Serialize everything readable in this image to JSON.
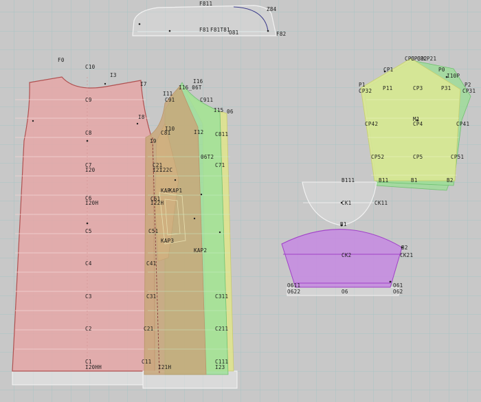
{
  "canvas": {
    "background": "#c8c8c8",
    "grid_color": "#a9c3c3"
  },
  "colors": {
    "front_piece": "#e7a8a8",
    "back_piece_tan": "#c9a67a",
    "back_piece_green": "#9fe09a",
    "back_piece_yellow": "#dfe48a",
    "sleeve_front": "#d9e795",
    "sleeve_back": "#9fdc9a",
    "collar_purple": "#c58ee0",
    "outline_white": "#efefef",
    "stroke_red": "#b05050",
    "stroke_purple": "#a040c8"
  },
  "pieces": {
    "top_collar": [
      "F811",
      "Z84",
      "F81",
      "F81T81",
      "O81",
      "F82"
    ],
    "front": [
      "F0",
      "C10",
      "I3",
      "I7",
      "C9",
      "I8",
      "C8",
      "I9",
      "C7",
      "I20",
      "C6",
      "I20H",
      "C5",
      "C4",
      "C3",
      "C2",
      "C1",
      "I20HH"
    ],
    "back": [
      "I16",
      "I16_06T",
      "I11",
      "C91",
      "C911",
      "I15",
      "06",
      "I10",
      "C81",
      "I12",
      "C811",
      "06T2",
      "C21",
      "I21",
      "I22C",
      "C71",
      "KAP",
      "C61",
      "I22H",
      "KAP1",
      "KAP3",
      "C51",
      "KAP2",
      "C41",
      "C31",
      "C311",
      "C21",
      "C211",
      "C11",
      "I21H",
      "C111",
      "I23"
    ],
    "sleeve": [
      "CP3",
      "CP31",
      "CP2",
      "CP21",
      "I10P",
      "CP1",
      "P0",
      "P1",
      "P2",
      "CP32",
      "P11",
      "CP3",
      "CP31",
      "P31",
      "CP42",
      "M1",
      "CP4",
      "CP41",
      "CP52",
      "CP5",
      "CP51",
      "B11",
      "B1",
      "B2"
    ],
    "cuff": [
      "B111",
      "CK1",
      "CK11"
    ],
    "collar": [
      "B1",
      "B2",
      "CK2",
      "CK21",
      "O611",
      "O61",
      "O622",
      "O6",
      "O62"
    ]
  }
}
